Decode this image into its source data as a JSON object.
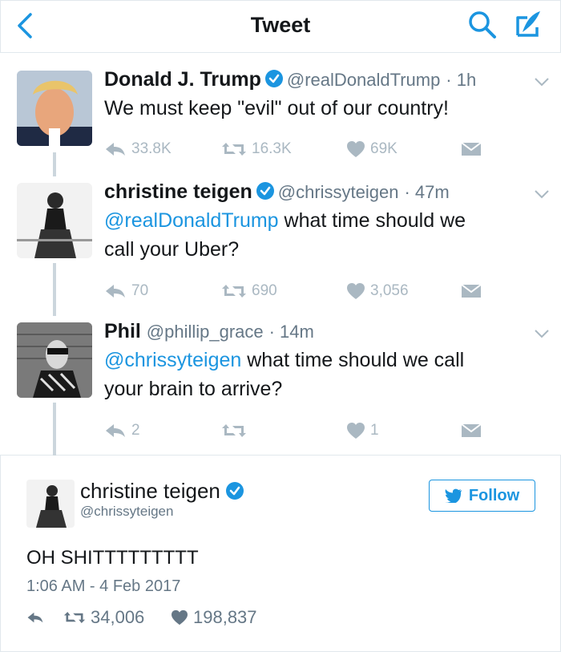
{
  "header": {
    "title": "Tweet"
  },
  "tweets": [
    {
      "name": "Donald J. Trump",
      "handle": "@realDonaldTrump",
      "time": "· 1h",
      "verified": true,
      "text": "We must keep \"evil\" out of our country!",
      "replies": "33.8K",
      "retweets": "16.3K",
      "likes": "69K"
    },
    {
      "name": "christine teigen",
      "handle": "@chrissyteigen",
      "time": "· 47m",
      "verified": true,
      "mention": "@realDonaldTrump",
      "text_line1": " what time should we",
      "text_line2": "call your Uber?",
      "replies": "70",
      "retweets": "690",
      "likes": "3,056"
    },
    {
      "name": "Phil",
      "handle": "@phillip_grace",
      "time": "· 14m",
      "verified": false,
      "mention": "@chrissyteigen",
      "text_line1": " what time should we call",
      "text_line2": "your brain to arrive?",
      "replies": "2",
      "retweets": "",
      "likes": "1"
    }
  ],
  "main": {
    "name": "christine teigen",
    "handle": "@chrissyteigen",
    "follow_label": "Follow",
    "text": "OH SHITTTTTTTTT",
    "timestamp": "1:06 AM - 4 Feb 2017",
    "retweets": "34,006",
    "likes": "198,837"
  },
  "colors": {
    "accent": "#1b95e0",
    "icon_gray": "#aab8c2",
    "thread_line": "#ccd6dd"
  }
}
